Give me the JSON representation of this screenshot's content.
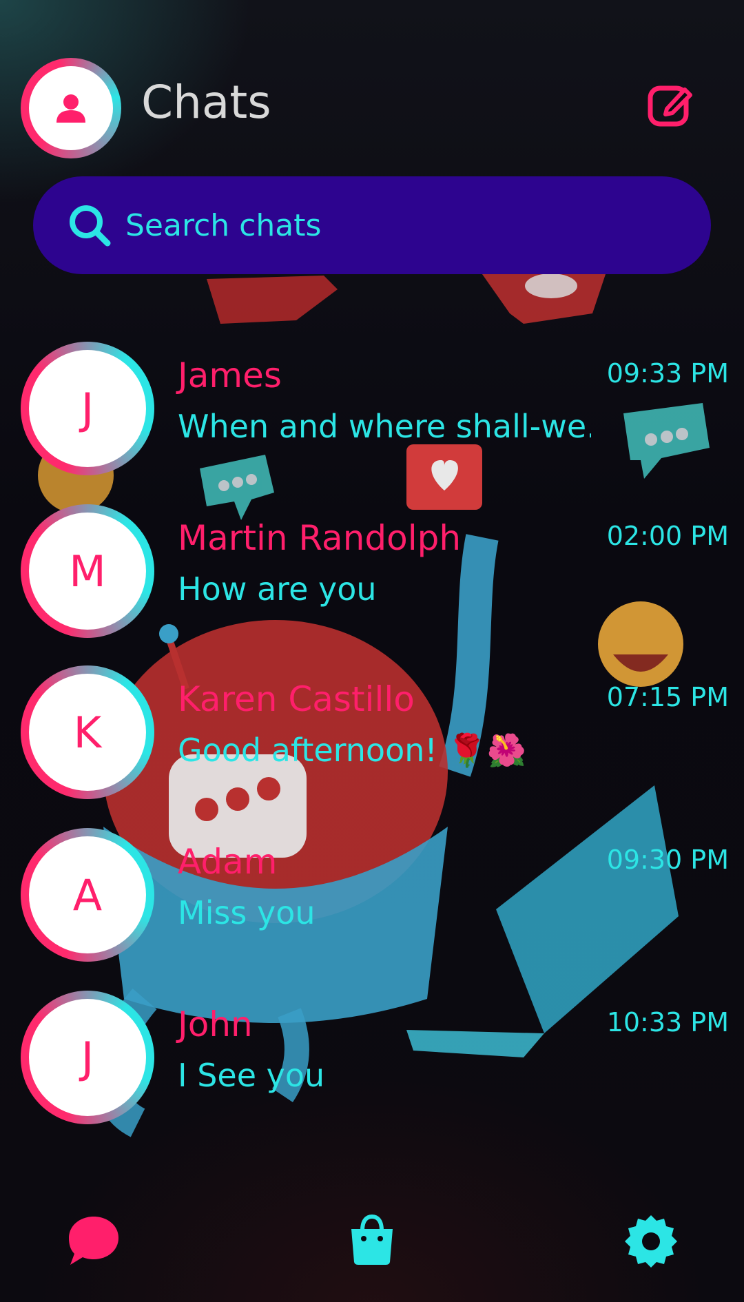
{
  "header": {
    "title": "Chats",
    "profile_icon": "person-icon",
    "compose_icon": "compose-icon"
  },
  "search": {
    "placeholder": "Search chats",
    "icon": "search-icon"
  },
  "chats": [
    {
      "initial": "J",
      "name": "James",
      "message": "When and where shall-we...",
      "time": "09:33 PM"
    },
    {
      "initial": "M",
      "name": "Martin Randolph",
      "message": "How are you",
      "time": "02:00 PM"
    },
    {
      "initial": "K",
      "name": "Karen Castillo",
      "message": "Good afternoon! 🌹🌺",
      "time": "07:15 PM"
    },
    {
      "initial": "A",
      "name": "Adam",
      "message": "Miss you",
      "time": "09:30 PM"
    },
    {
      "initial": "J",
      "name": "John",
      "message": "I See you",
      "time": "10:33 PM"
    }
  ],
  "bottom_nav": [
    {
      "icon": "chat-bubble-icon"
    },
    {
      "icon": "shopping-bag-icon"
    },
    {
      "icon": "settings-gear-icon"
    }
  ],
  "colors": {
    "accent_pink": "#ff1f6b",
    "accent_cyan": "#2ce5e5",
    "search_bg": "#2d048f",
    "background": "#0b0910"
  }
}
